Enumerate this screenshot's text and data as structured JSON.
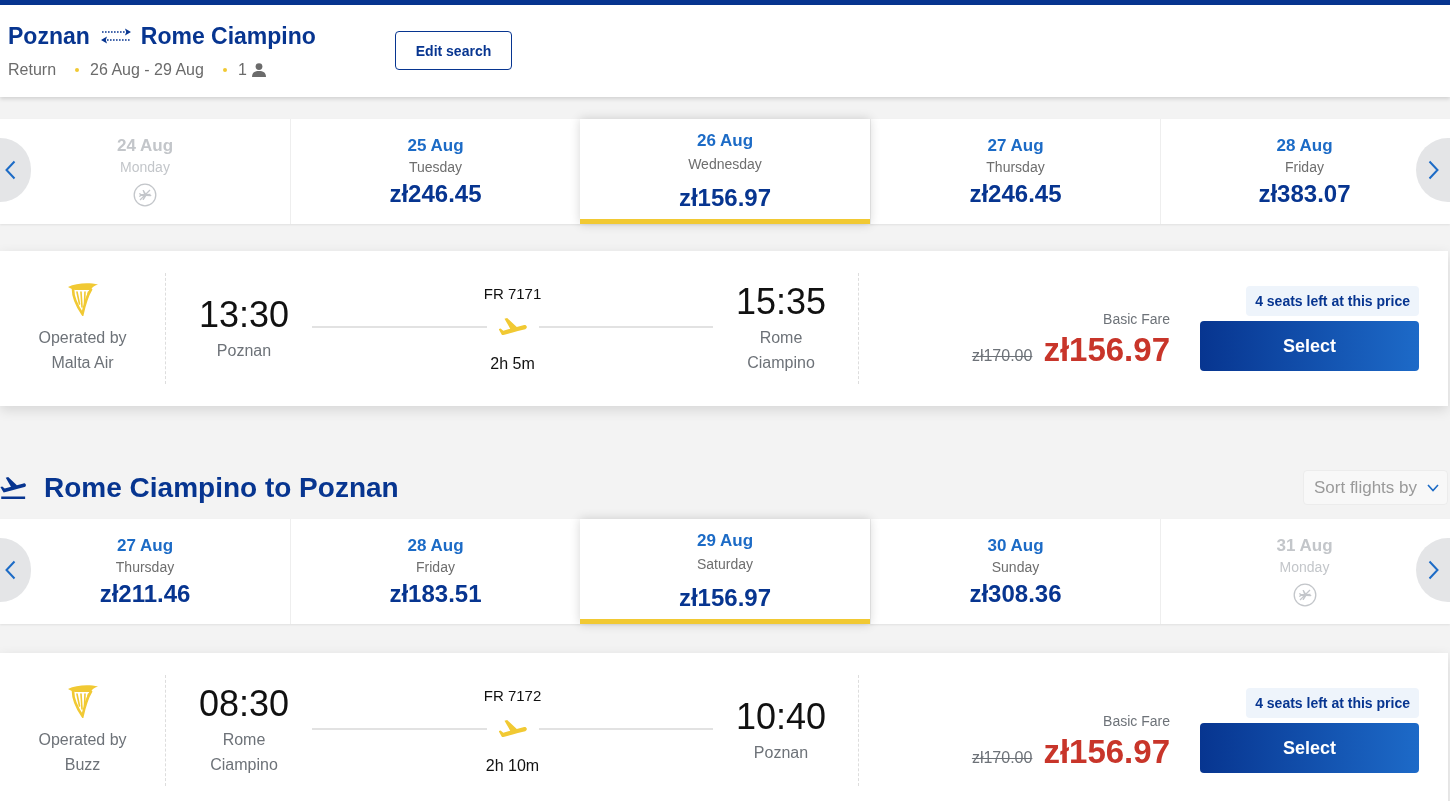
{
  "header": {
    "origin": "Poznan",
    "destination": "Rome Ciampino",
    "trip_type": "Return",
    "dates": "26 Aug - 29 Aug",
    "passengers": "1",
    "edit_button": "Edit search"
  },
  "sections": [
    {
      "dates": [
        {
          "date": "24 Aug",
          "day": "Monday",
          "disabled": true,
          "selected": false
        },
        {
          "date": "25 Aug",
          "day": "Tuesday",
          "price": "zł246.45",
          "disabled": false,
          "selected": false
        },
        {
          "date": "26 Aug",
          "day": "Wednesday",
          "price": "zł156.97",
          "disabled": false,
          "selected": true
        },
        {
          "date": "27 Aug",
          "day": "Thursday",
          "price": "zł246.45",
          "disabled": false,
          "selected": false
        },
        {
          "date": "28 Aug",
          "day": "Friday",
          "price": "zł383.07",
          "disabled": false,
          "selected": false
        }
      ],
      "flights": [
        {
          "operator": "Operated by Malta Air",
          "departure_time": "13:30",
          "departure_city": "Poznan",
          "flight_number": "FR 7171",
          "duration": "2h 5m",
          "arrival_time": "15:35",
          "arrival_city": "Rome Ciampino",
          "fare_label": "Basic Fare",
          "old_price": "zł170.00",
          "price": "zł156.97",
          "seats_badge": "4 seats left at this price",
          "select_button": "Select"
        }
      ]
    },
    {
      "title": "Rome Ciampino to Poznan",
      "sort_button": "Sort flights by",
      "dates": [
        {
          "date": "27 Aug",
          "day": "Thursday",
          "price": "zł211.46",
          "disabled": false,
          "selected": false
        },
        {
          "date": "28 Aug",
          "day": "Friday",
          "price": "zł183.51",
          "disabled": false,
          "selected": false
        },
        {
          "date": "29 Aug",
          "day": "Saturday",
          "price": "zł156.97",
          "disabled": false,
          "selected": true
        },
        {
          "date": "30 Aug",
          "day": "Sunday",
          "price": "zł308.36",
          "disabled": false,
          "selected": false
        },
        {
          "date": "31 Aug",
          "day": "Monday",
          "disabled": true,
          "selected": false
        }
      ],
      "flights": [
        {
          "operator": "Operated by Buzz",
          "departure_time": "08:30",
          "departure_city": "Rome Ciampino",
          "flight_number": "FR 7172",
          "duration": "2h 10m",
          "arrival_time": "10:40",
          "arrival_city": "Poznan",
          "fare_label": "Basic Fare",
          "old_price": "zł170.00",
          "price": "zł156.97",
          "seats_badge": "4 seats left at this price",
          "select_button": "Select"
        }
      ]
    }
  ]
}
